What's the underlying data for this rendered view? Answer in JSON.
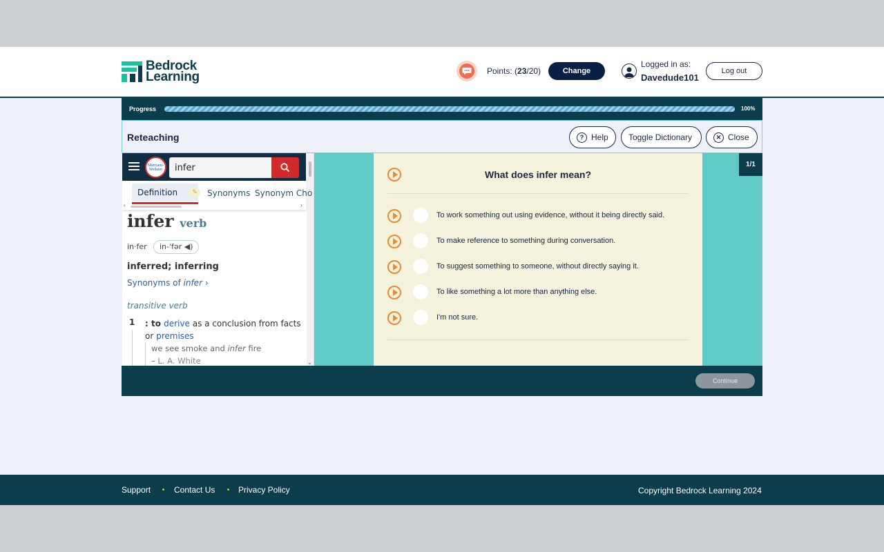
{
  "header": {
    "logo_line1": "Bedrock",
    "logo_line2": "Learning",
    "points_prefix": "Points: (",
    "points_current": "23",
    "points_suffix": "/20)",
    "change_label": "Change",
    "logged_label": "Logged in as:",
    "username": "Davedude101",
    "logout_label": "Log out"
  },
  "progress": {
    "label": "Progress",
    "value_percent": 100,
    "value_text": "100%"
  },
  "toolbar": {
    "title": "Reteaching",
    "help_label": "Help",
    "toggle_dictionary_label": "Toggle Dictionary",
    "close_label": "Close"
  },
  "dictionary": {
    "logo_text": "Merriam-Webster",
    "search_value": "infer",
    "tabs": [
      "Definition",
      "Synonyms",
      "Synonym Cho"
    ],
    "headword": "infer",
    "part_of_speech": "verb",
    "syllables": "in·fer",
    "pronunciation": "in-ˈfər",
    "inflections": "inferred; inferring",
    "synonyms_prefix": "Synonyms of ",
    "synonyms_word": "infer",
    "synonyms_arrow": "›",
    "verb_type": "transitive verb",
    "sense_number": "1",
    "sense_prefix": ": to ",
    "sense_link1": "derive",
    "sense_middle": " as a conclusion from facts or ",
    "sense_link2": "premises",
    "example_pre": "we see smoke and ",
    "example_word": "infer",
    "example_post": " fire",
    "example_dash": "–",
    "example_author": " L. A. White"
  },
  "question": {
    "title": "What does infer mean?",
    "counter": "1/1",
    "options": [
      "To work something out using evidence, without it being directly said.",
      "To make reference to something during conversation.",
      "To suggest something to someone, without directly saying it.",
      "To like something a lot more than anything else.",
      "I'm not sure."
    ],
    "continue_label": "Continue"
  },
  "footer": {
    "links": [
      "Support",
      "Contact Us",
      "Privacy Policy"
    ],
    "copyright": "Copyright Bedrock Learning 2024"
  },
  "colors": {
    "brand_dark": "#0b3d4d",
    "brand_teal": "#1fbfa0",
    "accent_orange": "#ef8a2a",
    "card_bg": "#f4f1dd",
    "question_bg": "#5fcac6",
    "mw_red": "#d22a2a"
  },
  "icons": {
    "points": "speech-bubble-icon",
    "user": "user-icon",
    "help": "question-circle-icon",
    "close": "close-circle-icon",
    "search": "search-icon",
    "menu": "hamburger-icon",
    "audio": "speaker-icon",
    "play": "play-icon"
  }
}
